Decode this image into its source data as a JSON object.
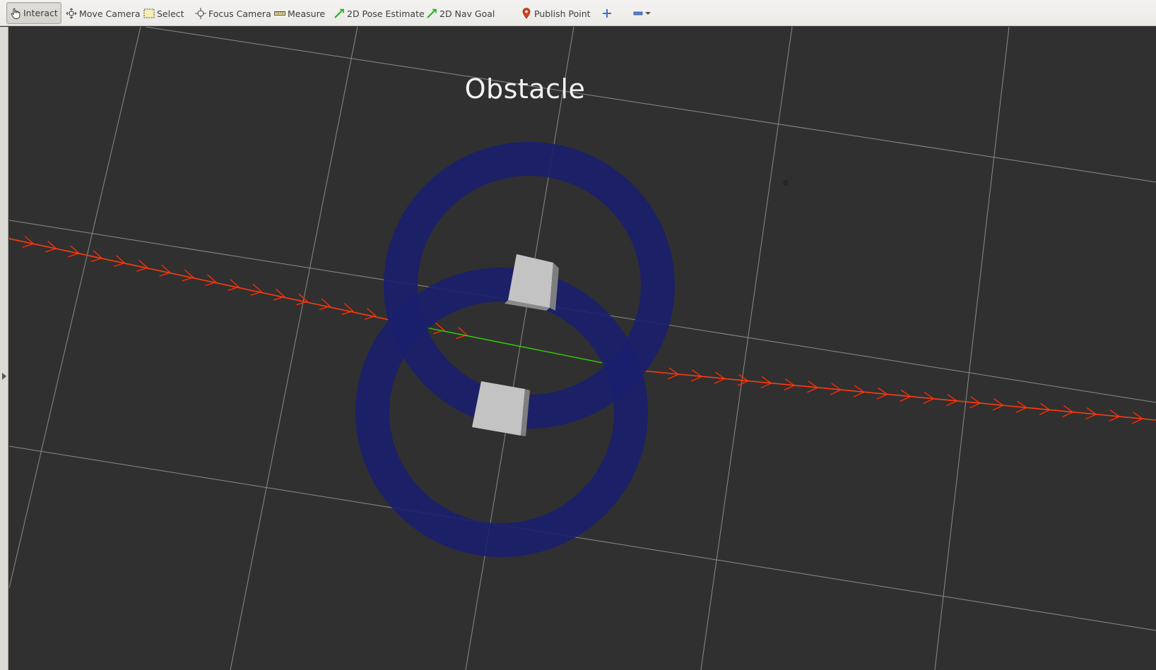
{
  "toolbar": {
    "tools": [
      {
        "label": "Interact",
        "icon": "hand-pointer-icon",
        "active": true
      },
      {
        "label": "Move Camera",
        "icon": "move-camera-icon"
      },
      {
        "label": "Select",
        "icon": "select-rectangle-icon"
      },
      {
        "label": "Focus Camera",
        "icon": "focus-camera-icon"
      },
      {
        "label": "Measure",
        "icon": "ruler-icon"
      },
      {
        "label": "2D Pose Estimate",
        "icon": "green-arrow-icon"
      },
      {
        "label": "2D Nav Goal",
        "icon": "green-arrow-icon"
      },
      {
        "label": "Publish Point",
        "icon": "map-pin-icon"
      }
    ],
    "add_tool_icon": "plus-icon",
    "remove_tool_icon": "minus-icon",
    "dropdown_icon": "chevron-down-icon"
  },
  "viewport": {
    "marker_text": "Obstacle",
    "colors": {
      "background": "#303030",
      "grid": "#a0a0a0",
      "path_arrows": "#ff2a00",
      "path_segment": "#32d000",
      "inflation_ring": "#1a1f6e",
      "obstacle": "#c3c3c3"
    }
  }
}
